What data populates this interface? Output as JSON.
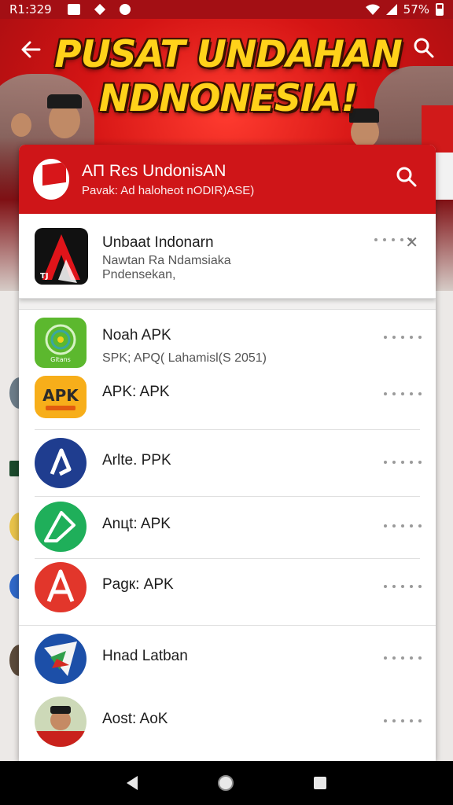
{
  "status_bar": {
    "time": "R1:329",
    "battery": "57%",
    "icons": [
      "gallery-icon",
      "sparkle-icon",
      "notification-icon",
      "wifi-icon",
      "signal-icon",
      "battery-icon"
    ]
  },
  "banner": {
    "headline": "PUSAT UNDAHAN NDNONESIA!",
    "back_icon": "arrow-left-icon",
    "search_icon": "search-icon"
  },
  "sheet": {
    "title": "AП Rєs UndonisAN",
    "subtitle": "Pavak: Ad haloheot nODIR)ASE)",
    "search_icon": "search-icon"
  },
  "featured": {
    "name": "Unbaat Indonarn",
    "desc_line1": "Nawtan Ra Ndamsiaka",
    "desc_line2": "Pndensekan,",
    "close_icon": "close-icon",
    "icon_badge": "TJ"
  },
  "apps": [
    {
      "name": "Noah APK",
      "desc": "SPK; APQ( Lahamisl(S 2051)",
      "icon": "green-radar-icon",
      "icon_label": "Gitans"
    },
    {
      "name": "APK: APK",
      "desc": "",
      "icon": "apk-orange-icon",
      "icon_label": "APK"
    },
    {
      "name": "Arlte. PPK",
      "desc": "",
      "icon": "navy-a-icon"
    },
    {
      "name": "Anцt: APK",
      "desc": "",
      "icon": "green-triangle-icon"
    },
    {
      "name": "Pagк: APK",
      "desc": "",
      "icon": "red-a-icon"
    },
    {
      "name": "Hnad Latban",
      "desc": "",
      "icon": "star-paper-icon"
    },
    {
      "name": "Aost: AoK",
      "desc": "",
      "icon": "avatar-icon"
    }
  ],
  "colors": {
    "brand_red": "#cf1518",
    "headline_yellow": "#ffd21a",
    "status_red": "#a30f14"
  },
  "nav": [
    "nav-back-icon",
    "nav-home-icon",
    "nav-recent-icon"
  ]
}
